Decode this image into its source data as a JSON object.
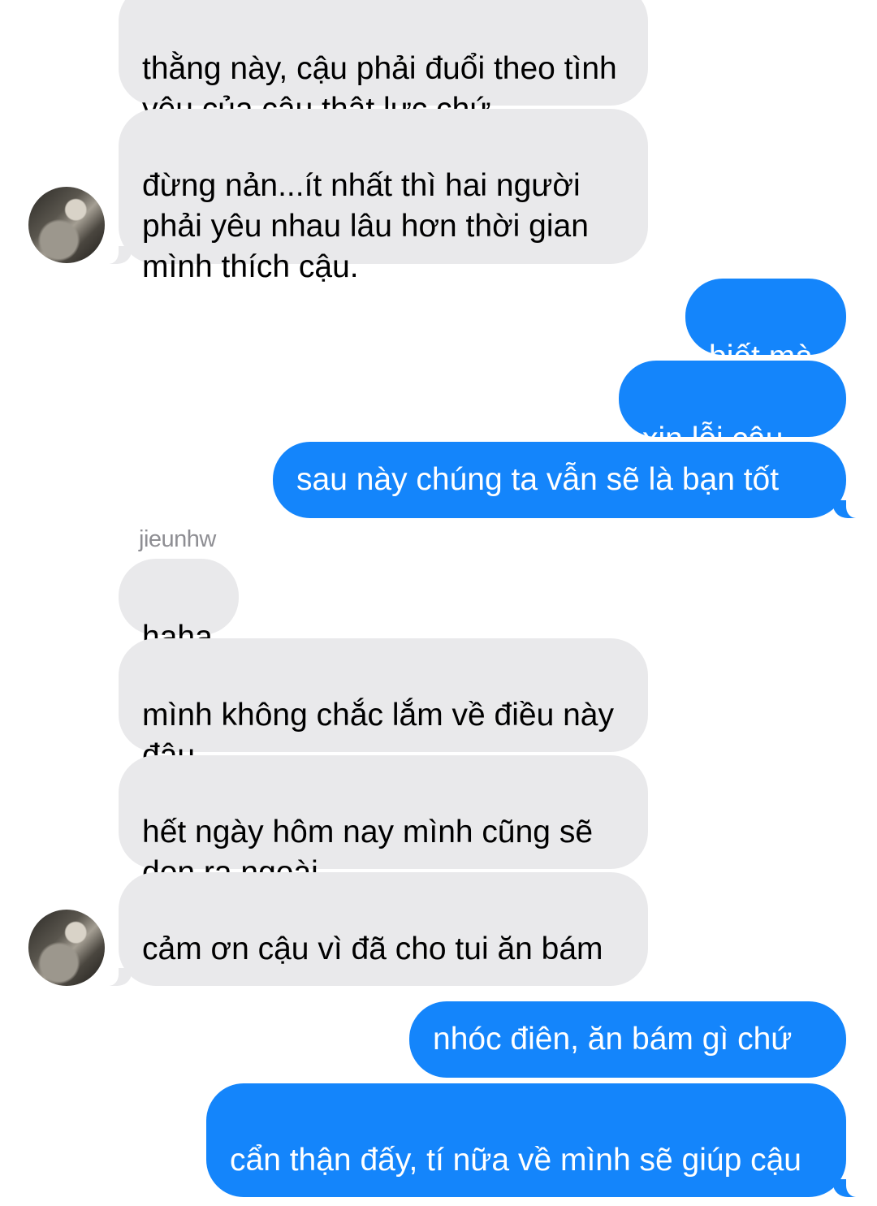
{
  "conversation": {
    "sender_name": "jieunhw",
    "messages": [
      {
        "from": "them",
        "text": "thằng này, cậu phải đuổi theo tình yêu của cậu thật lực chứ"
      },
      {
        "from": "them",
        "text": "đừng nản...ít nhất thì hai người phải yêu nhau lâu hơn thời gian mình thích cậu."
      },
      {
        "from": "me",
        "text": "biết mà"
      },
      {
        "from": "me",
        "text": "xin lỗi cậu..."
      },
      {
        "from": "me",
        "text": "sau này chúng ta vẫn sẽ là bạn tốt"
      },
      {
        "from": "them",
        "text": "haha"
      },
      {
        "from": "them",
        "text": "mình không chắc lắm về điều này đâu.."
      },
      {
        "from": "them",
        "text": "hết ngày hôm nay mình cũng sẽ dọn ra ngoài"
      },
      {
        "from": "them",
        "text": "cảm ơn cậu vì đã cho tui ăn bám"
      },
      {
        "from": "me",
        "text": "nhóc điên, ăn bám gì chứ"
      },
      {
        "from": "me",
        "text": "cẩn thận đấy, tí nữa về mình sẽ giúp cậu"
      }
    ]
  },
  "colors": {
    "incoming_bubble": "#e9e9eb",
    "outgoing_bubble": "#1485fb",
    "sender_name": "#8e8e93"
  }
}
